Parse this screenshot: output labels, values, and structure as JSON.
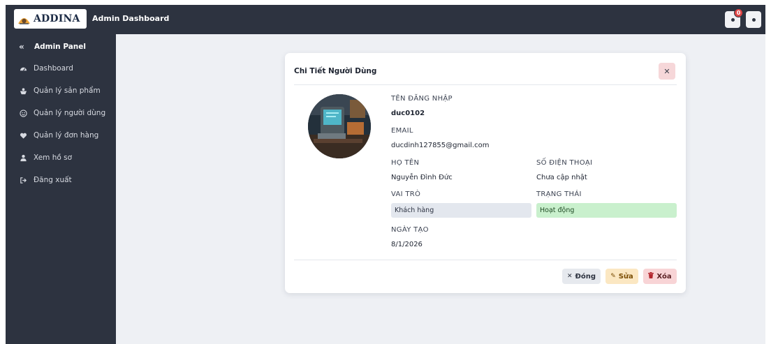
{
  "header": {
    "brand": "ADDINA",
    "app_title": "Admin Dashboard",
    "notification_count": "0"
  },
  "sidebar": {
    "panel_title": "Admin Panel",
    "items": [
      {
        "label": "Dashboard",
        "icon": "dashboard-icon"
      },
      {
        "label": "Quản lý sản phẩm",
        "icon": "products-icon"
      },
      {
        "label": "Quản lý người dùng",
        "icon": "users-icon"
      },
      {
        "label": "Quản lý đơn hàng",
        "icon": "heart-icon"
      },
      {
        "label": "Xem hồ sơ",
        "icon": "user-icon"
      },
      {
        "label": "Đăng xuất",
        "icon": "logout-icon"
      }
    ]
  },
  "modal": {
    "title": "Chi Tiết Người Dùng",
    "username_label": "TÊN ĐĂNG NHẬP",
    "username": "duc0102",
    "email_label": "EMAIL",
    "email": "ducdinh127855@gmail.com",
    "fullname_label": "HỌ TÊN",
    "fullname": "Nguyễn Đình Đức",
    "phone_label": "SỐ ĐIỆN THOẠI",
    "phone": "Chưa cập nhật",
    "role_label": "VAI TRÒ",
    "role": "Khách hàng",
    "status_label": "TRẠNG THÁI",
    "status": "Hoạt động",
    "created_label": "NGÀY TẠO",
    "created": "8/1/2026",
    "buttons": {
      "close": "Đóng",
      "edit": "Sửa",
      "delete": "Xóa"
    }
  },
  "colors": {
    "sidebar_bg": "#2d3340",
    "page_bg": "#eef0f4",
    "status_active_bg": "#c9f0cd",
    "role_bg": "#e3e7ee",
    "delete_bg": "#f8d4d6",
    "edit_bg": "#fbe7c2"
  }
}
